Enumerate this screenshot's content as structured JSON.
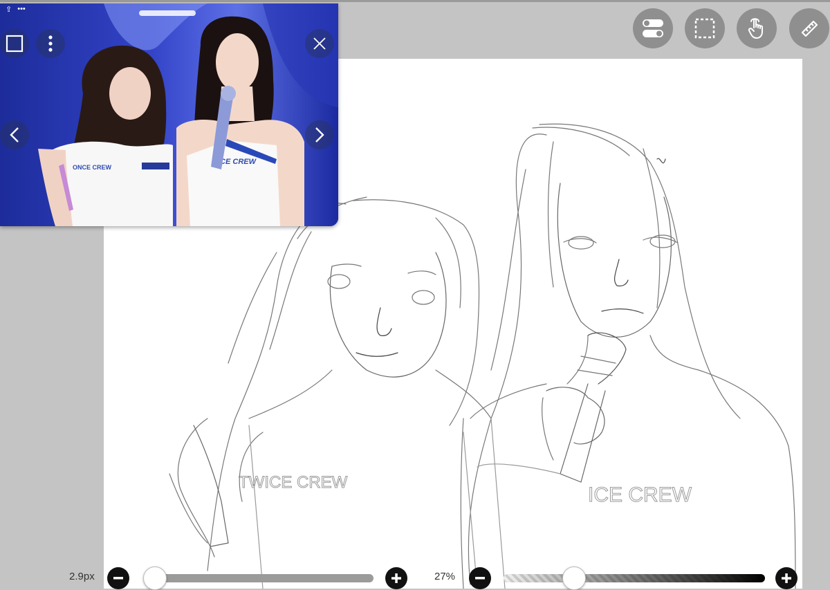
{
  "toolbar": {
    "items": [
      {
        "icon": "toggle-icon"
      },
      {
        "icon": "selection-icon"
      },
      {
        "icon": "hand-gesture-icon"
      },
      {
        "icon": "ruler-icon"
      }
    ]
  },
  "reference_window": {
    "photo_text_left": "ONCE CREW",
    "photo_text_right": "ICE CREW"
  },
  "canvas": {
    "sketch_text_left": "TWICE CREW",
    "sketch_text_right": "ICE CREW"
  },
  "brush_size": {
    "label": "2.9px",
    "level": 0.02
  },
  "opacity": {
    "label": "27%",
    "level": 0.27
  },
  "colors": {
    "background": "#c4c4c4",
    "button": "#8f8f8f",
    "photo_bg": "#1b2a9e"
  }
}
